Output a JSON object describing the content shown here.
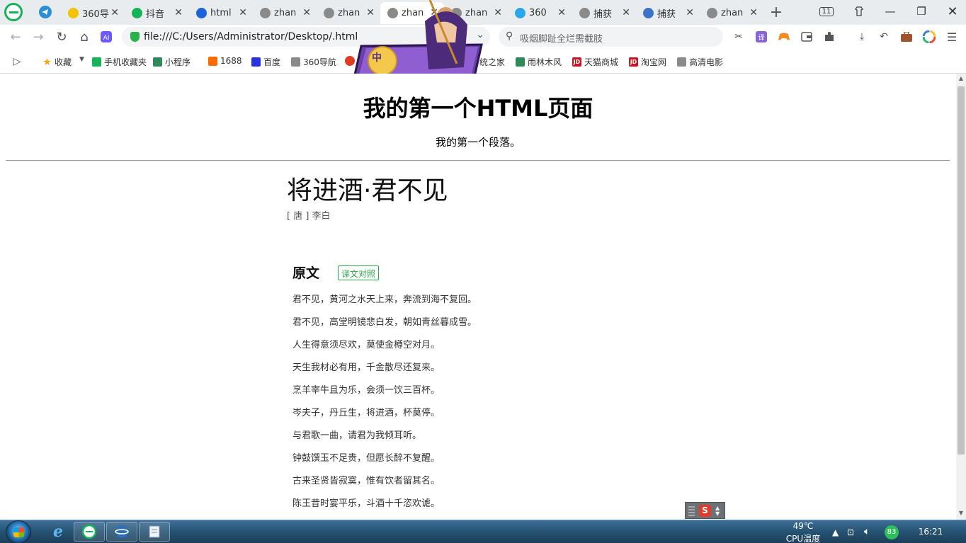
{
  "browser": {
    "tabs": [
      {
        "label": "360导",
        "icon": "plus-circle-icon",
        "color": "#f5c400",
        "active": false
      },
      {
        "label": "抖音",
        "icon": "search-icon",
        "color": "#16b35a",
        "active": false
      },
      {
        "label": "html",
        "icon": "doc-icon",
        "color": "#1a63d9",
        "active": false
      },
      {
        "label": "zhan",
        "icon": "globe-icon",
        "color": "#8a8a8a",
        "active": false
      },
      {
        "label": "zhan",
        "icon": "globe-icon",
        "color": "#8a8a8a",
        "active": false
      },
      {
        "label": "zhan",
        "icon": "globe-icon",
        "color": "#8a8a8a",
        "active": true
      },
      {
        "label": "zhan",
        "icon": "globe-icon",
        "color": "#8a8a8a",
        "active": false
      },
      {
        "label": "360",
        "icon": "shield-icon",
        "color": "#29a7e8",
        "active": false
      },
      {
        "label": "捕获",
        "icon": "globe-icon",
        "color": "#8a8a8a",
        "active": false
      },
      {
        "label": "捕获",
        "icon": "image-icon",
        "color": "#3a73c8",
        "active": false
      },
      {
        "label": "zhan",
        "icon": "globe-icon",
        "color": "#8a8a8a",
        "active": false
      }
    ],
    "tab_count": "11",
    "address": "file:///C:/Users/Administrator/Desktop/.html",
    "search_placeholder": "吸烟脚趾全烂需截肢",
    "bookmarks": [
      {
        "label": "收藏",
        "icon": "star-icon",
        "color": "#f3a712"
      },
      {
        "label": "手机收藏夹",
        "icon": "phone-icon",
        "color": "#16b35a"
      },
      {
        "label": "小程序",
        "icon": "shield-icon",
        "color": "#2e8b57"
      },
      {
        "label": "1688",
        "icon": "1688-icon",
        "color": "#ff6a00"
      },
      {
        "label": "百度",
        "icon": "paw-icon",
        "color": "#2932e1"
      },
      {
        "label": "360导航",
        "icon": "globe-icon",
        "color": "#8a8a8a"
      },
      {
        "label": "统之家",
        "icon": "globe-icon",
        "color": "#8a8a8a"
      },
      {
        "label": "雨林木风",
        "icon": "tree-icon",
        "color": "#2e8b57"
      },
      {
        "label": "天猫商城",
        "icon": "jd-icon",
        "color": "#c91623"
      },
      {
        "label": "淘宝网",
        "icon": "jd-icon",
        "color": "#c91623"
      },
      {
        "label": "高清电影",
        "icon": "globe-icon",
        "color": "#8a8a8a"
      }
    ]
  },
  "badge": {
    "label": "中"
  },
  "page": {
    "heading": "我的第一个HTML页面",
    "paragraph": "我的第一个段落。",
    "poem_title": "将进酒·君不见",
    "poem_author": "[ 唐 ] 李白",
    "section_title": "原文",
    "section_button": "译文对照",
    "lines": [
      "君不见，黄河之水天上来，奔流到海不复回。",
      "君不见，高堂明镜悲白发，朝如青丝暮成雪。",
      "人生得意须尽欢，莫使金樽空对月。",
      "天生我材必有用，千金散尽还复来。",
      "烹羊宰牛且为乐，会须一饮三百杯。",
      "岑夫子，丹丘生，将进酒，杯莫停。",
      "与君歌一曲，请君为我倾耳听。",
      "钟鼓馔玉不足贵，但愿长醉不复醒。",
      "古来圣贤皆寂寞，惟有饮者留其名。",
      "陈王昔时宴平乐，斗酒十千恣欢谑。"
    ]
  },
  "taskbar": {
    "temp": "49℃",
    "temp_label": "CPU温度",
    "cpu_value": "83",
    "clock": "16:21"
  }
}
